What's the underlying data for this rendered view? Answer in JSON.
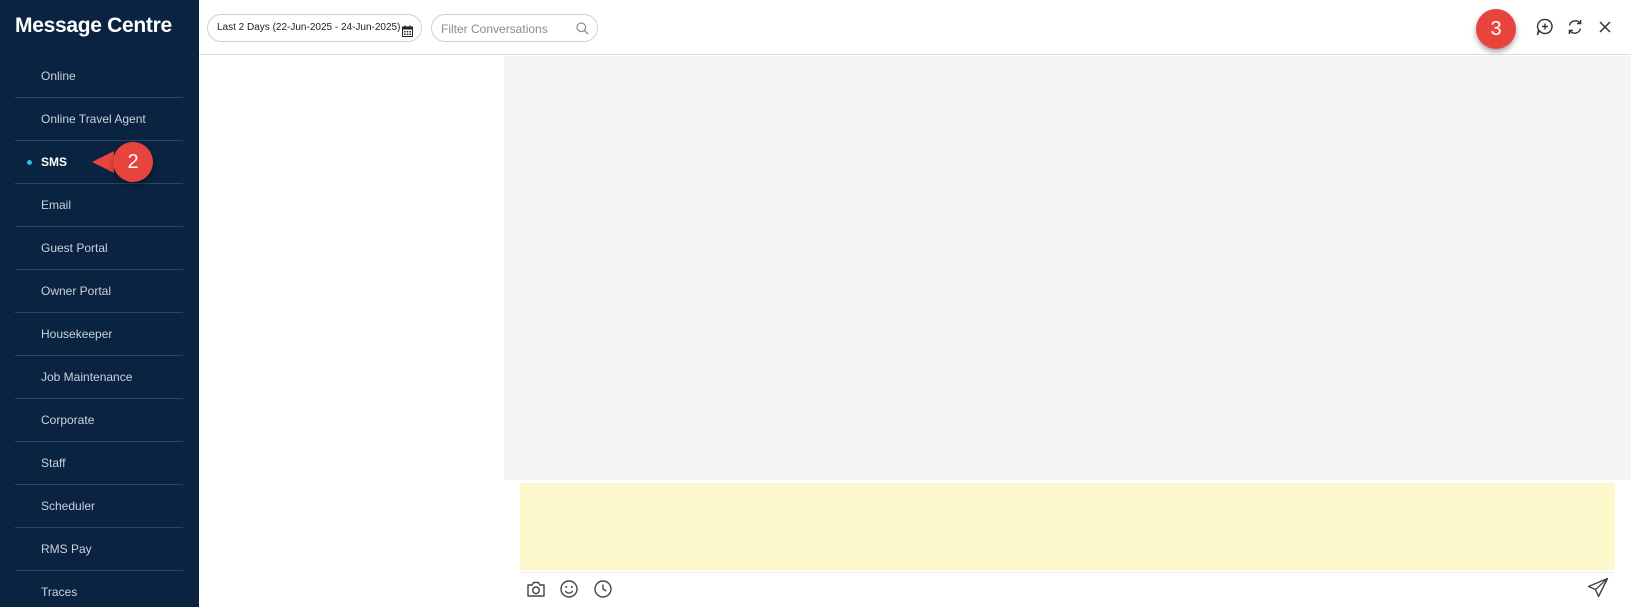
{
  "sidebar": {
    "title": "Message Centre",
    "items": [
      {
        "label": "Online",
        "active": false
      },
      {
        "label": "Online Travel Agent",
        "active": false
      },
      {
        "label": "SMS",
        "active": true
      },
      {
        "label": "Email",
        "active": false
      },
      {
        "label": "Guest Portal",
        "active": false
      },
      {
        "label": "Owner Portal",
        "active": false
      },
      {
        "label": "Housekeeper",
        "active": false
      },
      {
        "label": "Job Maintenance",
        "active": false
      },
      {
        "label": "Corporate",
        "active": false
      },
      {
        "label": "Staff",
        "active": false
      },
      {
        "label": "Scheduler",
        "active": false
      },
      {
        "label": "RMS Pay",
        "active": false
      },
      {
        "label": "Traces",
        "active": false
      }
    ],
    "active_dot_color": "#23c2ea"
  },
  "toolbar": {
    "date_range_label": "Last 2 Days (22-Jun-2025 - 24-Jun-2025)",
    "date_icon": "calendar-icon",
    "filter": {
      "placeholder": "Filter Conversations",
      "value": "",
      "icon": "search-icon"
    },
    "actions": [
      {
        "name": "new-conversation-icon"
      },
      {
        "name": "refresh-icon"
      },
      {
        "name": "close-icon"
      }
    ]
  },
  "callouts": {
    "step_2": "2",
    "step_3": "3",
    "color": "#e8443e"
  },
  "compose": {
    "value": "",
    "background": "#fdf8cc",
    "tools": [
      "camera-icon",
      "emoji-icon",
      "clock-icon"
    ],
    "send_icon": "send-icon"
  }
}
